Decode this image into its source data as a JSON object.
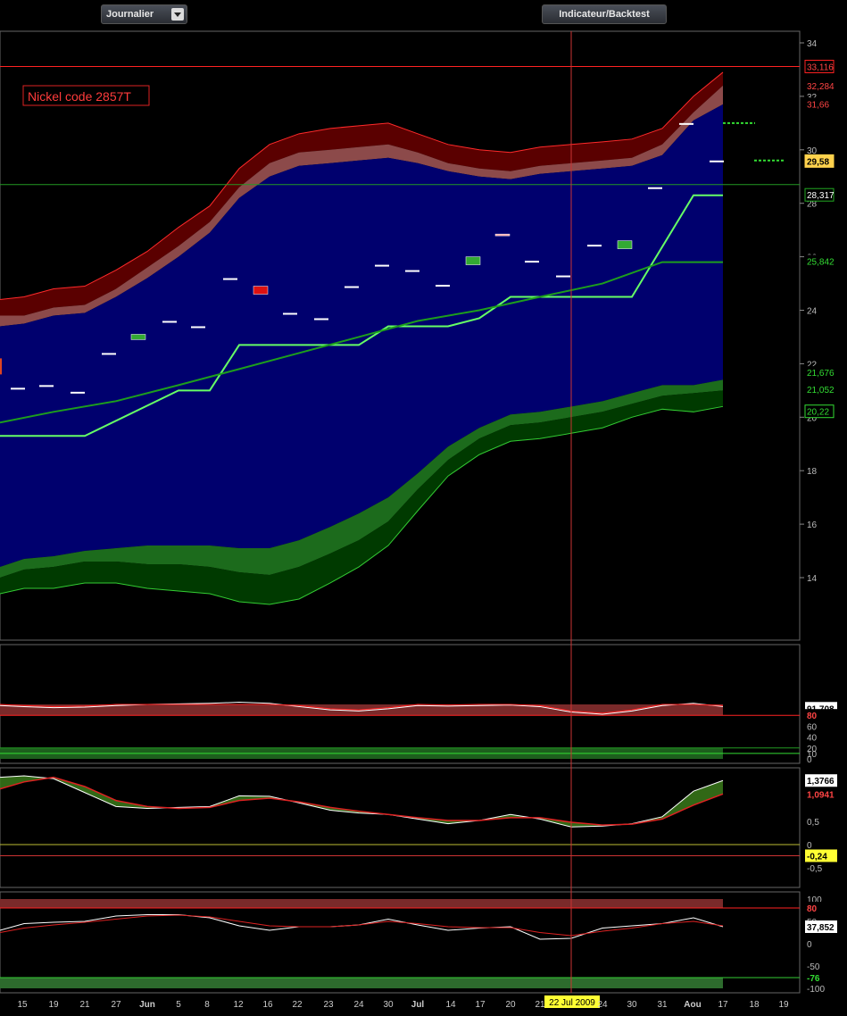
{
  "toolbar": {
    "period_select": "Journalier",
    "indicator_button": "Indicateur/Backtest"
  },
  "main_chart": {
    "annotation": "Nickel code 2857T",
    "y_ticks": [
      "34",
      "32",
      "30",
      "28",
      "26",
      "24",
      "22",
      "20",
      "18",
      "16",
      "14"
    ],
    "price_labels": [
      {
        "text": "33,116",
        "value": 33.116,
        "color": "#ff4444",
        "bg": "#000",
        "border": "#ff2222"
      },
      {
        "text": "32,284",
        "value": 32.4,
        "color": "#ff4444",
        "bg": "#000",
        "border": ""
      },
      {
        "text": "31,66",
        "value": 31.72,
        "color": "#ff4444",
        "bg": "#000",
        "border": ""
      },
      {
        "text": "29,58",
        "value": 29.58,
        "color": "#000",
        "bg": "#ffd24d",
        "border": "#ffd24d"
      },
      {
        "text": "28,317",
        "value": 28.317,
        "color": "#ffffff",
        "bg": "#000",
        "border": "#22aa22"
      },
      {
        "text": "25,842",
        "value": 25.842,
        "color": "#33dd33",
        "bg": "#000",
        "border": ""
      },
      {
        "text": "21,676",
        "value": 21.676,
        "color": "#33dd33",
        "bg": "#000",
        "border": ""
      },
      {
        "text": "21,052",
        "value": 21.052,
        "color": "#33dd33",
        "bg": "#000",
        "border": ""
      },
      {
        "text": "20,22",
        "value": 20.22,
        "color": "#33dd33",
        "bg": "#000",
        "border": "#33dd33"
      }
    ],
    "hline_red": 33.116,
    "hline_green": 28.7,
    "date_marker": "22 Jul 2009"
  },
  "osc1": {
    "y_ticks": [
      "60",
      "40",
      "20",
      "10",
      "0"
    ],
    "labels": [
      {
        "text": "91,708",
        "color": "#000",
        "bg": "#ffffff"
      },
      {
        "text": "80",
        "color": "#ff4444",
        "bg": "#000"
      }
    ]
  },
  "osc2": {
    "y_ticks": [
      "0,5",
      "0",
      "-0,5"
    ],
    "labels": [
      {
        "text": "1,3766",
        "color": "#000",
        "bg": "#ffffff"
      },
      {
        "text": "1,0941",
        "color": "#ff4444",
        "bg": "#000"
      },
      {
        "text": "-0,24",
        "color": "#000",
        "bg": "#ffff33"
      }
    ]
  },
  "osc3": {
    "y_ticks": [
      "100",
      "50",
      "0",
      "-50",
      "-100"
    ],
    "labels": [
      {
        "text": "80",
        "color": "#ff4444",
        "bg": "#000"
      },
      {
        "text": "37,852",
        "color": "#000",
        "bg": "#ffffff"
      },
      {
        "text": "-76",
        "color": "#33dd33",
        "bg": "#000"
      }
    ]
  },
  "x_axis_labels": [
    "15",
    "19",
    "21",
    "27",
    "Jun",
    "5",
    "8",
    "12",
    "16",
    "22",
    "23",
    "24",
    "30",
    "Jul",
    "14",
    "17",
    "20",
    "21",
    "24",
    "30",
    "31",
    "Aou",
    "17",
    "18",
    "19"
  ],
  "chart_data": {
    "type": "line",
    "title": "Nickel code 2857T",
    "series": [
      {
        "name": "",
        "values": [
          19.3,
          19.3,
          19.3,
          20.3,
          21.0,
          22.7,
          22.7,
          22.7,
          23.4,
          23.5,
          24.5,
          24.5,
          28.3
        ]
      },
      {
        "name": "",
        "values": [
          19.8,
          20.2,
          20.6,
          21.2,
          21.8,
          22.4,
          23.0,
          23.6,
          24.0,
          24.5,
          25.0,
          25.8
        ]
      }
    ],
    "x": [
      "15",
      "21",
      "Jun",
      "8",
      "12",
      "22",
      "30",
      "Jul",
      "17",
      "21",
      "30",
      "31",
      "Aou"
    ],
    "ylim": [
      12.5,
      34.5
    ]
  }
}
